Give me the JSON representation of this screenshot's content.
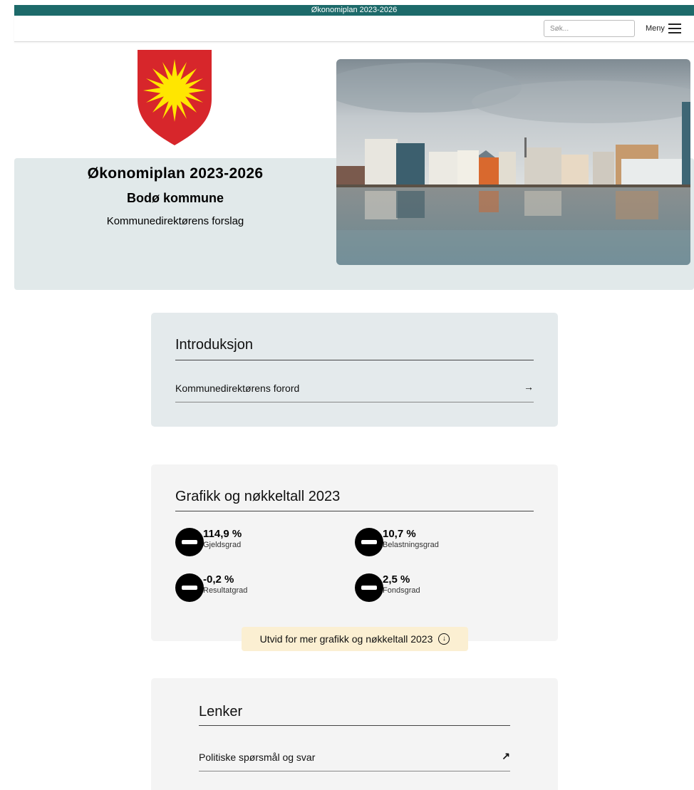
{
  "topbar": {
    "title": "Økonomiplan 2023-2026"
  },
  "header": {
    "search_placeholder": "Søk...",
    "menu_label": "Meny"
  },
  "hero": {
    "title": "Økonomiplan 2023-2026",
    "subtitle": "Bodø kommune",
    "subtitle2": "Kommunedirektørens forslag"
  },
  "intro": {
    "title": "Introduksjon",
    "links": [
      {
        "label": "Kommunedirektørens forord",
        "arrow": "→"
      }
    ]
  },
  "keyfigures": {
    "title": "Grafikk og nøkkeltall 2023",
    "items": [
      {
        "value": "114,9 %",
        "label": "Gjeldsgrad",
        "icon": "minus-circle-icon"
      },
      {
        "value": "10,7 %",
        "label": "Belastningsgrad",
        "icon": "minus-circle-icon"
      },
      {
        "value": "-0,2 %",
        "label": "Resultatgrad",
        "icon": "minus-circle-icon"
      },
      {
        "value": "2,5 %",
        "label": "Fondsgrad",
        "icon": "minus-circle-icon"
      }
    ],
    "expand_label": "Utvid for mer grafikk og nøkkeltall 2023",
    "expand_icon": "↓"
  },
  "links": {
    "title": "Lenker",
    "items": [
      {
        "label": "Politiske spørsmål og svar",
        "arrow": "↗"
      }
    ]
  },
  "colors": {
    "topbar": "#1d6a6a",
    "hero_bg": "#e1e9ea",
    "card_bg": "#f4f4f4",
    "expand_bg": "#fbefd2",
    "crest_red": "#d7262b",
    "crest_yellow": "#ffe600"
  }
}
